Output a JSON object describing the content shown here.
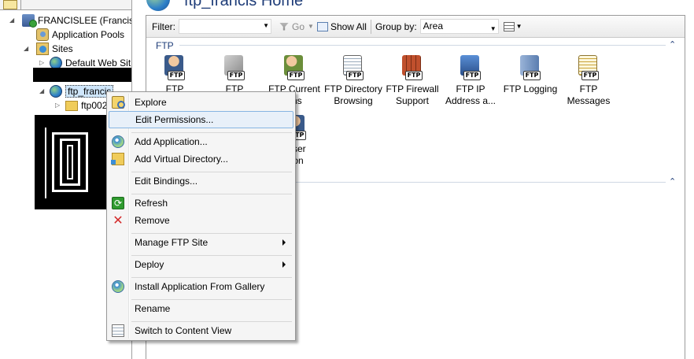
{
  "tree": {
    "server_label": "FRANCISLEE (FrancisLe",
    "app_pools_label": "Application Pools",
    "sites_label": "Sites",
    "default_site_label": "Default Web Sit",
    "ftp_site_label": "ftp_francis",
    "ftp_child_label": "ftp002"
  },
  "header": {
    "title": "ftp_francis Home"
  },
  "filterbar": {
    "filter_label": "Filter:",
    "filter_value": "",
    "go_label": "Go",
    "show_all_label": "Show All",
    "group_by_label": "Group by:",
    "group_by_value": "Area"
  },
  "groups": [
    {
      "title": "FTP"
    }
  ],
  "features": [
    {
      "line1": "FTP",
      "line2": ""
    },
    {
      "line1": "FTP",
      "line2": ""
    },
    {
      "line1": "FTP Current",
      "line2": "ons"
    },
    {
      "line1": "FTP Directory",
      "line2": "Browsing"
    },
    {
      "line1": "FTP Firewall",
      "line2": "Support"
    },
    {
      "line1": "FTP IP",
      "line2": "Address a..."
    },
    {
      "line1": "FTP Logging",
      "line2": ""
    },
    {
      "line1": "FTP",
      "line2": "Messages"
    },
    {
      "line1": "User",
      "line2": "tion"
    }
  ],
  "icon_badge": "FTP",
  "context_menu": {
    "items": [
      {
        "label": "Explore",
        "icon": "explore-icon"
      },
      {
        "label": "Edit Permissions...",
        "icon": ""
      },
      {
        "label": "Add Application...",
        "icon": "add-application-icon"
      },
      {
        "label": "Add Virtual Directory...",
        "icon": "add-virtual-directory-icon"
      },
      {
        "label": "Edit Bindings...",
        "icon": ""
      },
      {
        "label": "Refresh",
        "icon": "refresh-icon"
      },
      {
        "label": "Remove",
        "icon": "remove-icon"
      },
      {
        "label": "Manage FTP Site",
        "icon": ""
      },
      {
        "label": "Deploy",
        "icon": ""
      },
      {
        "label": "Install Application From Gallery",
        "icon": "gallery-icon"
      },
      {
        "label": "Rename",
        "icon": ""
      },
      {
        "label": "Switch to Content View",
        "icon": "content-view-icon"
      }
    ]
  },
  "colors": {
    "highlight_bg": "#e8f0f9",
    "highlight_border": "#86b5e2",
    "title_blue": "#1e3c78"
  }
}
